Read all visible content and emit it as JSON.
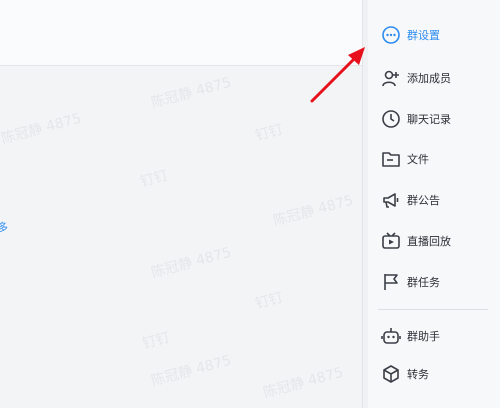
{
  "sidebar": {
    "items": [
      {
        "label": "群设置",
        "icon": "more-circle-icon",
        "active": true
      },
      {
        "label": "添加成员",
        "icon": "add-member-icon"
      },
      {
        "label": "聊天记录",
        "icon": "clock-icon"
      },
      {
        "label": "文件",
        "icon": "folder-icon"
      },
      {
        "label": "群公告",
        "icon": "megaphone-icon"
      },
      {
        "label": "直播回放",
        "icon": "tv-icon"
      },
      {
        "label": "群任务",
        "icon": "flag-icon"
      },
      {
        "label": "群助手",
        "icon": "robot-icon"
      },
      {
        "label": "转务",
        "icon": "box-icon"
      }
    ]
  },
  "main": {
    "edge_text": "多",
    "watermarks": [
      "陈冠静 4875",
      "钉钉",
      "陈冠静 4875",
      "钉钉",
      "陈冠静 4875",
      "钉钉",
      "陈冠静 4875",
      "钉钉",
      "陈冠静 4875",
      "钉钉"
    ]
  },
  "colors": {
    "accent": "#2d8cf0",
    "arrow": "#e8101c",
    "text": "#2b2f36"
  }
}
